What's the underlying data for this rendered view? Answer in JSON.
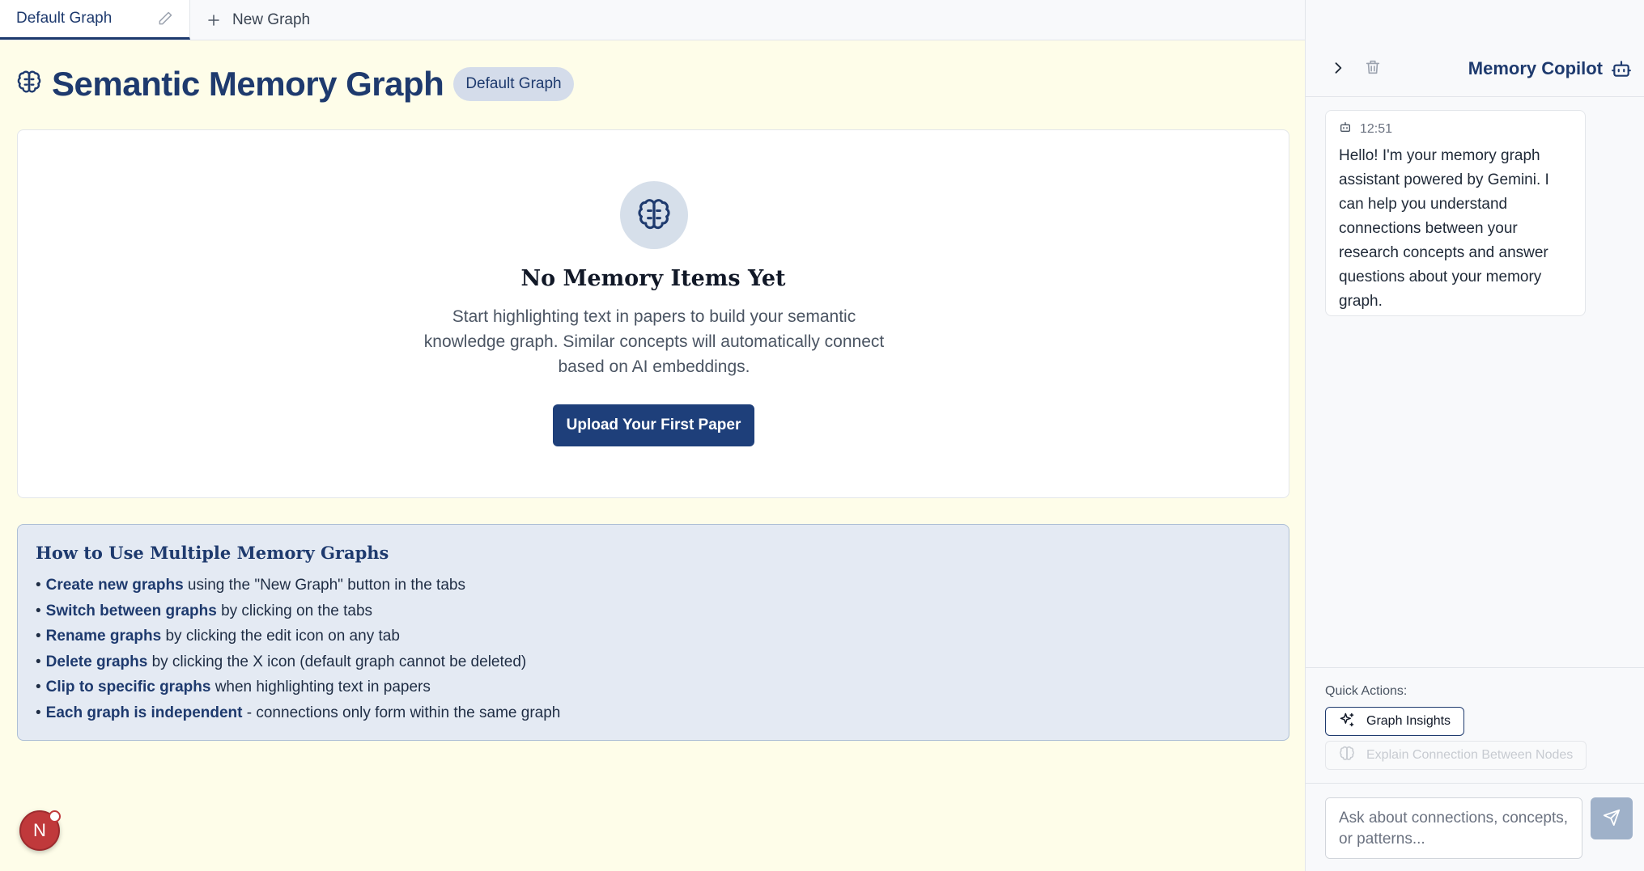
{
  "tabs": {
    "active_label": "Default Graph",
    "new_label": "New Graph"
  },
  "header": {
    "title": "Semantic Memory Graph",
    "badge": "Default Graph"
  },
  "empty_state": {
    "title": "No Memory Items Yet",
    "description": "Start highlighting text in papers to build your semantic knowledge graph. Similar concepts will automatically connect based on AI embeddings.",
    "button_label": "Upload Your First Paper"
  },
  "howto": {
    "title": "How to Use Multiple Memory Graphs",
    "items": [
      {
        "bold": "Create new graphs",
        "rest": " using the \"New Graph\" button in the tabs"
      },
      {
        "bold": "Switch between graphs",
        "rest": " by clicking on the tabs"
      },
      {
        "bold": "Rename graphs",
        "rest": " by clicking the edit icon on any tab"
      },
      {
        "bold": "Delete graphs",
        "rest": " by clicking the X icon (default graph cannot be deleted)"
      },
      {
        "bold": "Clip to specific graphs",
        "rest": " when highlighting text in papers"
      },
      {
        "bold": "Each graph is independent",
        "rest": " - connections only form within the same graph"
      }
    ]
  },
  "user": {
    "avatar_initial": "N"
  },
  "copilot": {
    "title": "Memory Copilot",
    "message": {
      "time": "12:51",
      "text": "Hello! I'm your memory graph assistant powered by Gemini. I can help you understand connections between your research concepts and answer questions about your memory graph."
    },
    "quick_actions_label": "Quick Actions:",
    "quick_actions": [
      "Graph Insights",
      "Explain Connection Between Nodes"
    ],
    "input_placeholder": "Ask about connections, concepts, or patterns..."
  },
  "colors": {
    "primary": "#1e3a6e",
    "page_background": "#fefde9",
    "avatar": "#c0393b",
    "send_button": "#9fb1c9"
  },
  "icons": [
    "pencil-icon",
    "plus-icon",
    "brain-icon",
    "chevron-right-icon",
    "trash-icon",
    "bot-icon",
    "sparkles-icon",
    "send-icon"
  ]
}
